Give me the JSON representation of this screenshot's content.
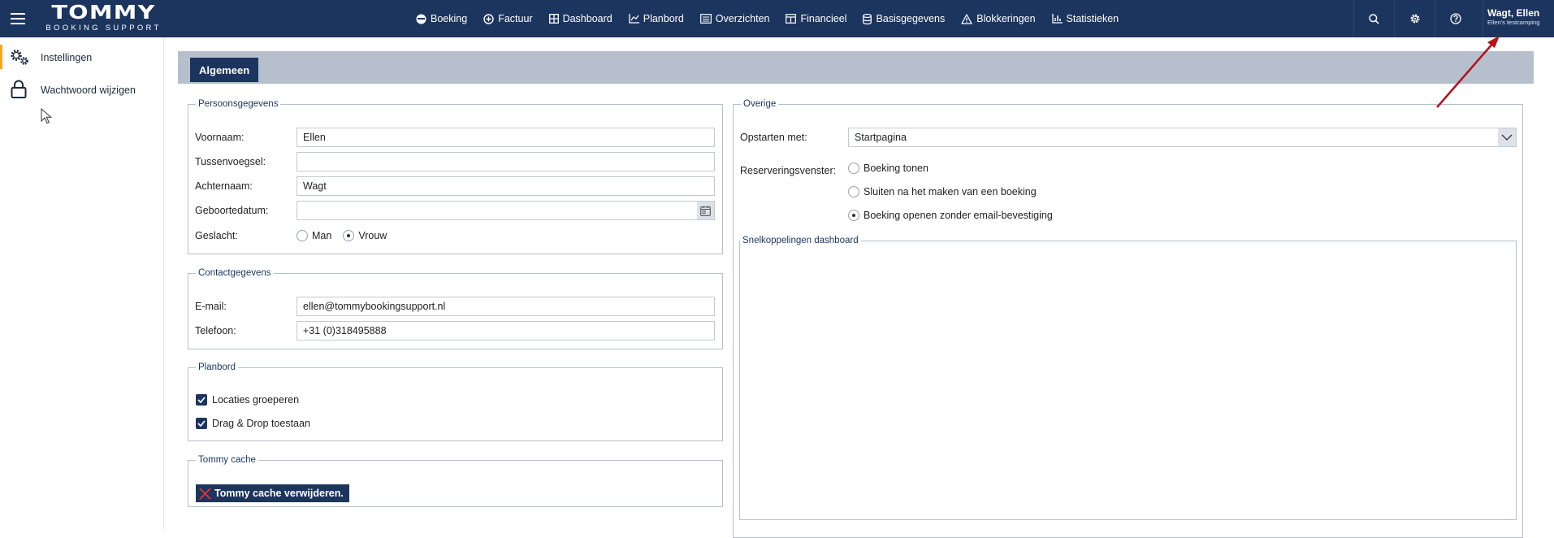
{
  "header": {
    "logo_main": "TOMMY",
    "logo_sub": "BOOKING SUPPORT",
    "nav": [
      {
        "label": "Boeking",
        "icon": "booking-icon"
      },
      {
        "label": "Factuur",
        "icon": "plus-circle-icon"
      },
      {
        "label": "Dashboard",
        "icon": "dashboard-icon"
      },
      {
        "label": "Planbord",
        "icon": "chart-icon"
      },
      {
        "label": "Overzichten",
        "icon": "list-icon"
      },
      {
        "label": "Financieel",
        "icon": "table-icon"
      },
      {
        "label": "Basisgegevens",
        "icon": "database-icon"
      },
      {
        "label": "Blokkeringen",
        "icon": "warning-icon"
      },
      {
        "label": "Statistieken",
        "icon": "bar-chart-icon"
      }
    ],
    "user_name": "Wagt, Ellen",
    "user_sub": "Ellen's testcamping"
  },
  "sidebar": {
    "items": [
      {
        "label": "Instellingen",
        "icon": "gears-icon"
      },
      {
        "label": "Wachtwoord wijzigen",
        "icon": "lock-icon"
      }
    ]
  },
  "tabs": [
    {
      "label": "Algemeen"
    }
  ],
  "personal": {
    "legend": "Persoonsgegevens",
    "first_name_label": "Voornaam:",
    "first_name": "Ellen",
    "infix_label": "Tussenvoegsel:",
    "infix": "",
    "last_name_label": "Achternaam:",
    "last_name": "Wagt",
    "birthdate_label": "Geboortedatum:",
    "birthdate": "",
    "gender_label": "Geslacht:",
    "gender_male": "Man",
    "gender_female": "Vrouw"
  },
  "contact": {
    "legend": "Contactgegevens",
    "email_label": "E-mail:",
    "email": "ellen@tommybookingsupport.nl",
    "phone_label": "Telefoon:",
    "phone": "+31 (0)318495888"
  },
  "planbord": {
    "legend": "Planbord",
    "group_locations": "Locaties groeperen",
    "drag_drop": "Drag & Drop toestaan"
  },
  "cache": {
    "legend": "Tommy cache",
    "button": "Tommy cache verwijderen."
  },
  "other": {
    "legend": "Overige",
    "start_label": "Opstarten met:",
    "start_value": "Startpagina",
    "reservation_label": "Reserveringsvenster:",
    "options": [
      "Boeking tonen",
      "Sluiten na het maken van een boeking",
      "Boeking openen zonder email-bevestiging"
    ],
    "shortcuts_legend": "Snelkoppelingen dashboard"
  },
  "colors": {
    "primary": "#1c355e",
    "tabbar": "#b6bfcc",
    "accent": "#f5a623",
    "arrow": "#b5121b"
  }
}
